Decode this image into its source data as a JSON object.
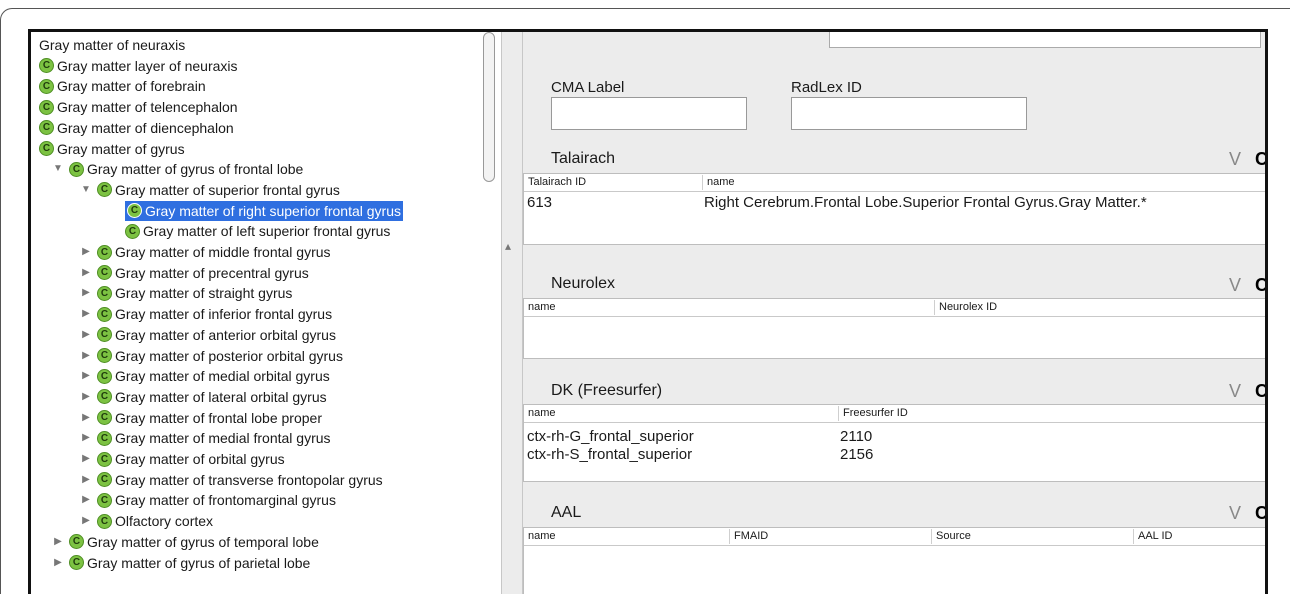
{
  "tree": {
    "items": [
      {
        "label": "Gray matter of neuraxis",
        "icon": false,
        "indent": 0,
        "toggle": ""
      },
      {
        "label": "Gray matter layer of neuraxis",
        "icon": true,
        "indent": 0,
        "toggle": ""
      },
      {
        "label": "Gray matter of forebrain",
        "icon": true,
        "indent": 0,
        "toggle": ""
      },
      {
        "label": "Gray matter of telencephalon",
        "icon": true,
        "indent": 0,
        "toggle": ""
      },
      {
        "label": "Gray matter of diencephalon",
        "icon": true,
        "indent": 0,
        "toggle": ""
      },
      {
        "label": "Gray matter of gyrus",
        "icon": true,
        "indent": 0,
        "toggle": ""
      },
      {
        "label": "Gray matter of gyrus of frontal lobe",
        "icon": true,
        "indent": 1,
        "toggle": "expanded"
      },
      {
        "label": "Gray matter of superior frontal gyrus",
        "icon": true,
        "indent": 2,
        "toggle": "expanded"
      },
      {
        "label": "Gray matter of right superior frontal gyrus",
        "icon": true,
        "indent": 3,
        "toggle": "",
        "selected": true
      },
      {
        "label": "Gray matter of left superior frontal gyrus",
        "icon": true,
        "indent": 3,
        "toggle": ""
      },
      {
        "label": "Gray matter of middle frontal gyrus",
        "icon": true,
        "indent": 2,
        "toggle": "collapsed"
      },
      {
        "label": "Gray matter of precentral gyrus",
        "icon": true,
        "indent": 2,
        "toggle": "collapsed"
      },
      {
        "label": "Gray matter of straight gyrus",
        "icon": true,
        "indent": 2,
        "toggle": "collapsed"
      },
      {
        "label": "Gray matter of inferior frontal gyrus",
        "icon": true,
        "indent": 2,
        "toggle": "collapsed"
      },
      {
        "label": "Gray matter of anterior orbital gyrus",
        "icon": true,
        "indent": 2,
        "toggle": "collapsed"
      },
      {
        "label": "Gray matter of posterior orbital gyrus",
        "icon": true,
        "indent": 2,
        "toggle": "collapsed"
      },
      {
        "label": "Gray matter of medial orbital gyrus",
        "icon": true,
        "indent": 2,
        "toggle": "collapsed"
      },
      {
        "label": "Gray matter of lateral orbital gyrus",
        "icon": true,
        "indent": 2,
        "toggle": "collapsed"
      },
      {
        "label": "Gray matter of frontal lobe proper",
        "icon": true,
        "indent": 2,
        "toggle": "collapsed"
      },
      {
        "label": "Gray matter of medial frontal gyrus",
        "icon": true,
        "indent": 2,
        "toggle": "collapsed"
      },
      {
        "label": "Gray matter of orbital gyrus",
        "icon": true,
        "indent": 2,
        "toggle": "collapsed"
      },
      {
        "label": "Gray matter of transverse frontopolar gyrus",
        "icon": true,
        "indent": 2,
        "toggle": "collapsed"
      },
      {
        "label": "Gray matter of frontomarginal gyrus",
        "icon": true,
        "indent": 2,
        "toggle": "collapsed"
      },
      {
        "label": "Olfactory cortex",
        "icon": true,
        "indent": 2,
        "toggle": "collapsed"
      },
      {
        "label": "Gray matter of gyrus of temporal lobe",
        "icon": true,
        "indent": 1,
        "toggle": "collapsed"
      },
      {
        "label": "Gray matter of gyrus of parietal lobe",
        "icon": true,
        "indent": 1,
        "toggle": "collapsed"
      }
    ],
    "icon_letter": "C",
    "icon_color": "#7cc242",
    "selection_color": "#2f6fe0"
  },
  "form": {
    "cma_label": "CMA Label",
    "cma_value": "",
    "radlex_label": "RadLex ID",
    "radlex_value": ""
  },
  "sections": {
    "v": "V",
    "c": "C",
    "talairach": {
      "title": "Talairach",
      "columns": [
        "Talairach ID",
        "name"
      ],
      "rows": [
        [
          "613",
          "Right Cerebrum.Frontal Lobe.Superior Frontal Gyrus.Gray Matter.*"
        ]
      ]
    },
    "neurolex": {
      "title": "Neurolex",
      "columns": [
        "name",
        "Neurolex ID"
      ],
      "rows": []
    },
    "dk": {
      "title": "DK (Freesurfer)",
      "columns": [
        "name",
        "Freesurfer ID"
      ],
      "rows": [
        [
          "ctx-rh-G_frontal_superior",
          "2110"
        ],
        [
          "ctx-rh-S_frontal_superior",
          "2156"
        ]
      ]
    },
    "aal": {
      "title": "AAL",
      "columns": [
        "name",
        "FMAID",
        "Source",
        "AAL ID"
      ],
      "rows": []
    }
  }
}
